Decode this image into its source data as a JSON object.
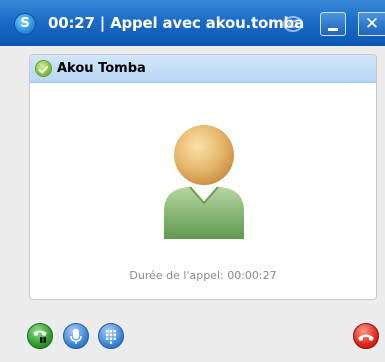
{
  "titlebar": {
    "title": "00:27 | Appel avec akou.tomba",
    "app_icon_letter": "S",
    "minimize_icon": "minimize-icon",
    "close_label": "✕"
  },
  "call": {
    "contact_name": "Akou Tomba",
    "status": "online",
    "duration_text": "Durée de l'appel: 00:00:27"
  },
  "controls": {
    "hold_icon": "phone-hold-icon",
    "mic_icon": "microphone-icon",
    "dialpad_icon": "dialpad-icon",
    "hangup_icon": "hang-up-icon"
  },
  "colors": {
    "titlebar": "#1a6bc7",
    "contact_bar": "#c5def8",
    "hangup": "#e3271b",
    "hold": "#2f9e2a"
  }
}
